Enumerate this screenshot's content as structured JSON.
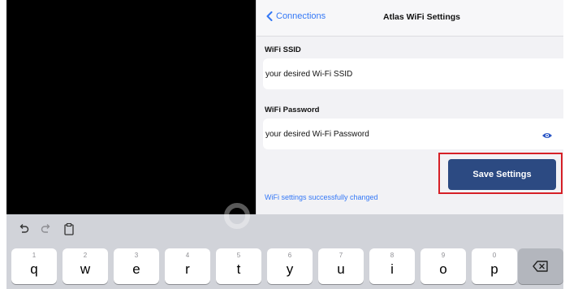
{
  "navbar": {
    "back_label": "Connections",
    "title": "Atlas WiFi Settings"
  },
  "ssid": {
    "label": "WiFi SSID",
    "value": "your desired Wi-Fi SSID"
  },
  "password": {
    "label": "WiFi Password",
    "value": "your desired Wi-Fi Password"
  },
  "save_label": "Save Settings",
  "status": "WiFi settings successfully changed",
  "colors": {
    "accent": "#3478f6",
    "button": "#2c4a82",
    "highlight": "#d62027"
  },
  "keyboard": {
    "toolbar_icons": [
      "undo-icon",
      "redo-icon",
      "clipboard-icon"
    ],
    "keys": [
      {
        "num": "1",
        "ch": "q"
      },
      {
        "num": "2",
        "ch": "w"
      },
      {
        "num": "3",
        "ch": "e"
      },
      {
        "num": "4",
        "ch": "r"
      },
      {
        "num": "5",
        "ch": "t"
      },
      {
        "num": "6",
        "ch": "y"
      },
      {
        "num": "7",
        "ch": "u"
      },
      {
        "num": "8",
        "ch": "i"
      },
      {
        "num": "9",
        "ch": "o"
      },
      {
        "num": "0",
        "ch": "p"
      }
    ],
    "delete_icon": "backspace-icon"
  }
}
